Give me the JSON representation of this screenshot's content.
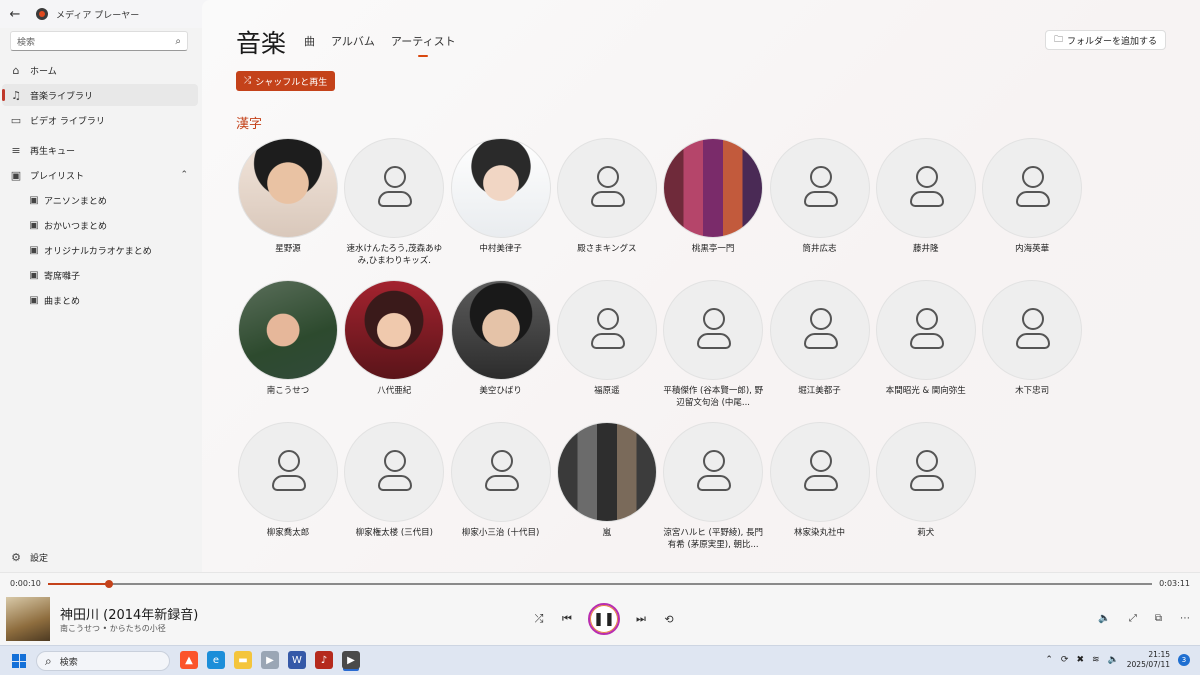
{
  "window": {
    "back_glyph": "←",
    "title": "メディア プレーヤー",
    "minimize_glyph": "—",
    "maximize_glyph": "▢",
    "close_glyph": "✕"
  },
  "sidebar": {
    "search_placeholder": "検索",
    "items": [
      {
        "label": "ホーム",
        "icon": "home-icon",
        "glyph": "⌂"
      },
      {
        "label": "音楽ライブラリ",
        "icon": "music-note-icon",
        "glyph": "♫"
      },
      {
        "label": "ビデオ ライブラリ",
        "icon": "video-icon",
        "glyph": "▭"
      },
      {
        "label": "再生キュー",
        "icon": "queue-icon",
        "glyph": "≡"
      },
      {
        "label": "プレイリスト",
        "icon": "playlist-icon",
        "glyph": "▣"
      }
    ],
    "playlists": [
      {
        "label": "アニソンまとめ"
      },
      {
        "label": "おかいつまとめ"
      },
      {
        "label": "オリジナルカラオケまとめ"
      },
      {
        "label": "寄席囃子"
      },
      {
        "label": "曲まとめ"
      }
    ],
    "settings_label": "設定"
  },
  "main": {
    "title": "音楽",
    "tabs": [
      "曲",
      "アルバム",
      "アーティスト"
    ],
    "active_tab": "アーティスト",
    "add_folder_label": "フォルダーを追加する",
    "shuffle_label": "シャッフルと再生",
    "section_title": "漢字",
    "artists": [
      {
        "name": "星野源",
        "photo": true
      },
      {
        "name": "速水けんたろう,茂森あゆみ,ひまわりキッズ.",
        "photo": false
      },
      {
        "name": "中村美律子",
        "photo": true
      },
      {
        "name": "殿さまキングス",
        "photo": false
      },
      {
        "name": "桃黒亭一門",
        "photo": true
      },
      {
        "name": "筒井広志",
        "photo": false
      },
      {
        "name": "藤井隆",
        "photo": false
      },
      {
        "name": "内海英華",
        "photo": false
      },
      {
        "name": "南こうせつ",
        "photo": true
      },
      {
        "name": "八代亜紀",
        "photo": true
      },
      {
        "name": "美空ひばり",
        "photo": true
      },
      {
        "name": "福原遥",
        "photo": false
      },
      {
        "name": "平積傑作 (谷本賢一郎), 野辺留文句治 (中尾...",
        "photo": false
      },
      {
        "name": "堀江美都子",
        "photo": false
      },
      {
        "name": "本間昭光 & 関向弥生",
        "photo": false
      },
      {
        "name": "木下忠司",
        "photo": false
      },
      {
        "name": "柳家喬太郎",
        "photo": false
      },
      {
        "name": "柳家権太楼 (三代目)",
        "photo": false
      },
      {
        "name": "柳家小三治 (十代目)",
        "photo": false
      },
      {
        "name": "嵐",
        "photo": true
      },
      {
        "name": "涼宮ハルヒ (平野綾), 長門有希 (茅原実里), 朝比...",
        "photo": false
      },
      {
        "name": "林家染丸社中",
        "photo": false
      },
      {
        "name": "莉犬",
        "photo": false
      }
    ]
  },
  "player": {
    "elapsed": "0:00:10",
    "duration": "0:03:11",
    "progress_fraction": 0.055,
    "track_title": "神田川 (2014年新録音)",
    "track_subtitle": "南こうせつ • からたちの小径",
    "accent_color": "#c4421a",
    "controls": {
      "shuffle": "⤮",
      "previous": "⏮",
      "pause": "❚❚",
      "next": "⏭",
      "repeat": "⟲"
    },
    "right_controls": {
      "volume": "🔈",
      "fullscreen": "⤢",
      "miniplayer": "⧉",
      "more": "⋯"
    }
  },
  "taskbar": {
    "search_label": "検索",
    "time": "21:15",
    "date": "2025/07/11",
    "notification_count": "3"
  }
}
